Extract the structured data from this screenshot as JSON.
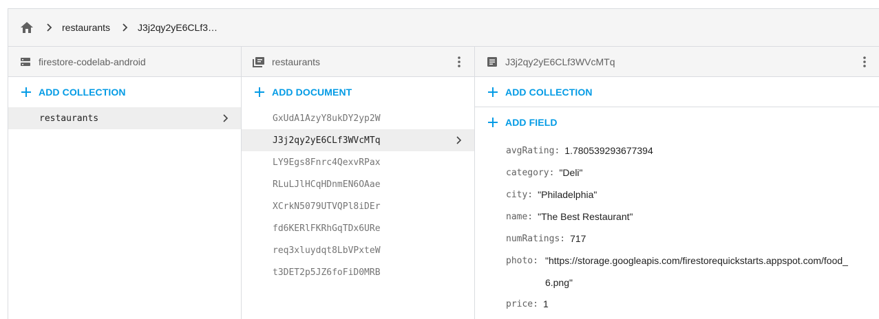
{
  "breadcrumb": {
    "items": [
      "restaurants",
      "J3j2qy2yE6CLf3…"
    ]
  },
  "columns": {
    "project": {
      "title": "firestore-codelab-android",
      "add_label": "ADD COLLECTION",
      "items": [
        "restaurants"
      ]
    },
    "collection": {
      "title": "restaurants",
      "add_label": "ADD DOCUMENT",
      "items": [
        "GxUdA1AzyY8ukDY2yp2W",
        "J3j2qy2yE6CLf3WVcMTq",
        "LY9Egs8Fnrc4QexvRPax",
        "RLuLJlHCqHDnmEN6OAae",
        "XCrkN5079UTVQPl8iDEr",
        "fd6KERlFKRhGqTDx6URe",
        "req3xluydqt8LbVPxteW",
        "t3DET2p5JZ6foFiD0MRB"
      ]
    },
    "document": {
      "title": "J3j2qy2yE6CLf3WVcMTq",
      "add_collection_label": "ADD COLLECTION",
      "add_field_label": "ADD FIELD",
      "fields": [
        {
          "key": "avgRating:",
          "value": "1.780539293677394"
        },
        {
          "key": "category:",
          "value": "\"Deli\""
        },
        {
          "key": "city:",
          "value": "\"Philadelphia\""
        },
        {
          "key": "name:",
          "value": "\"The Best Restaurant\""
        },
        {
          "key": "numRatings:",
          "value": "717"
        },
        {
          "key": "photo:",
          "value": "\"https://storage.googleapis.com/firestorequickstarts.appspot.com/food_6.png\""
        },
        {
          "key": "price:",
          "value": "1"
        }
      ]
    }
  },
  "icons": {
    "home": "home-icon",
    "breadcrumb_separator": "chevron-right-icon",
    "project": "database-icon",
    "collection": "collection-icon",
    "document": "document-icon",
    "menu": "more-vert-icon",
    "add": "plus-icon"
  },
  "colors": {
    "accent": "#039be5",
    "header_bg": "#f5f5f5",
    "selected_bg": "#eeeeee",
    "border": "#dadce0"
  }
}
